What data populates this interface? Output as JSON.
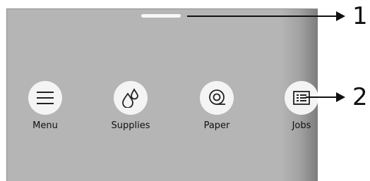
{
  "screen": {
    "apps": [
      {
        "label": "Menu",
        "icon": "hamburger-menu-icon"
      },
      {
        "label": "Supplies",
        "icon": "ink-drops-icon"
      },
      {
        "label": "Paper",
        "icon": "paper-roll-icon"
      },
      {
        "label": "Jobs",
        "icon": "job-list-icon"
      }
    ]
  },
  "callouts": [
    {
      "number": "1",
      "target": "swipe-handle"
    },
    {
      "number": "2",
      "target": "jobs-app"
    }
  ]
}
